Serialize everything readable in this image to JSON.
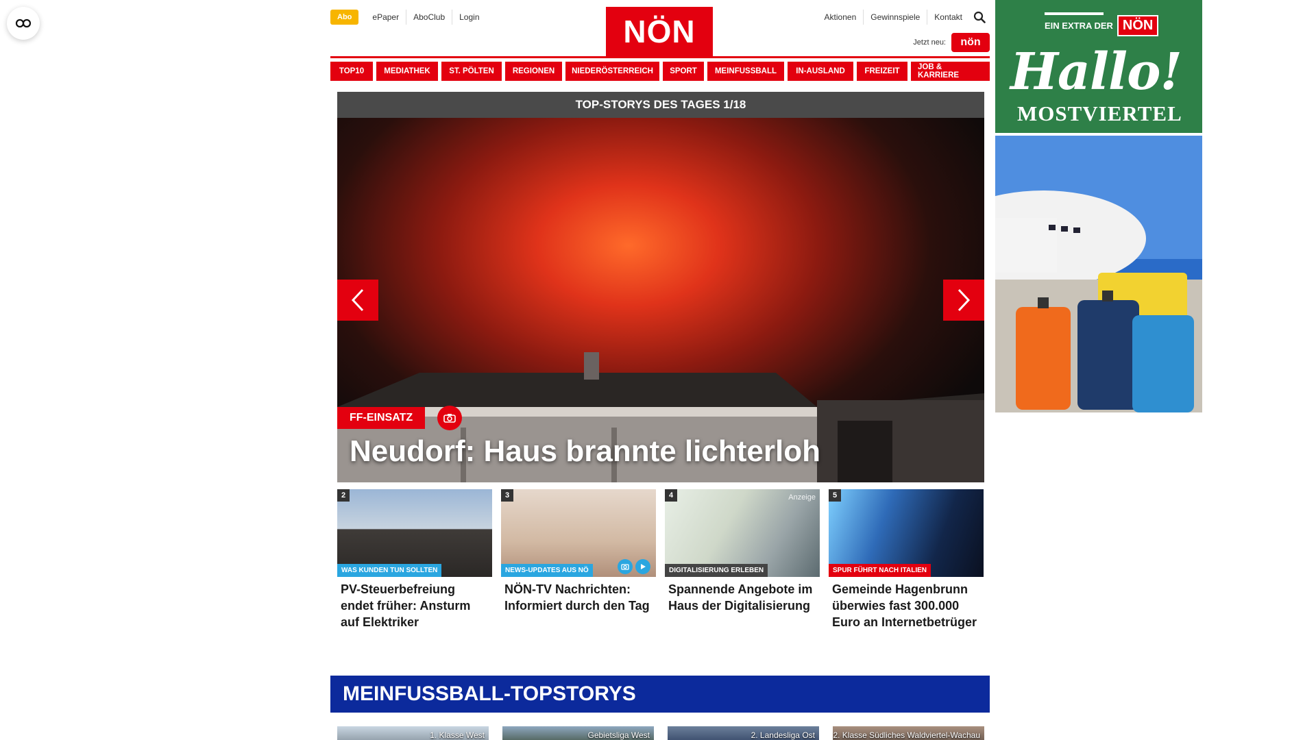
{
  "header": {
    "abo_label": "Abo",
    "epaper_label": "ePaper",
    "aboclub_label": "AboClub",
    "login_label": "Login",
    "logo_text": "NÖN",
    "aktionen_label": "Aktionen",
    "gewinnspiele_label": "Gewinnspiele",
    "kontakt_label": "Kontakt",
    "jetzt_neu_label": "Jetzt neu:",
    "mini_logo_text": "nön"
  },
  "nav": {
    "items": [
      {
        "label": "TOP10"
      },
      {
        "label": "MEDIATHEK"
      },
      {
        "label": "ST. PÖLTEN"
      },
      {
        "label": "REGIONEN"
      },
      {
        "label": "NIEDERÖSTERREICH"
      },
      {
        "label": "SPORT"
      },
      {
        "label": "MEINFUSSBALL"
      },
      {
        "label": "IN-AUSLAND"
      },
      {
        "label": "FREIZEIT"
      },
      {
        "label": "JOB & KARRIERE"
      }
    ]
  },
  "slider": {
    "header": "TOP-STORYS DES TAGES 1/18",
    "tag": "FF-EINSATZ",
    "title": "Neudorf: Haus brannte lichterloh"
  },
  "stories": [
    {
      "num": "2",
      "tag": "WAS KUNDEN TUN SOLLTEN",
      "tag_color": "#2aa6e0",
      "title": "PV-Steuerbefreiung endet früher: Ansturm auf Elektriker"
    },
    {
      "num": "3",
      "tag": "NEWS-UPDATES AUS NÖ",
      "tag_color": "#2aa6e0",
      "title": "NÖN-TV Nachrichten: Informiert durch den Tag"
    },
    {
      "num": "4",
      "tag": "DIGITALISIERUNG ERLEBEN",
      "tag_color": "#444444",
      "title": "Spannende Angebote im Haus der Digitalisierung",
      "badge": "Anzeige"
    },
    {
      "num": "5",
      "tag": "SPUR FÜHRT NACH ITALIEN",
      "tag_color": "#e3000f",
      "title": "Gemeinde Hagenbrunn überwies fast 300.000 Euro an Internetbetrüger"
    }
  ],
  "meinfussball": {
    "title": "MEINFUSSBALL-TOPSTORYS",
    "leagues": [
      {
        "label": "1. Klasse West"
      },
      {
        "label": "Gebietsliga West"
      },
      {
        "label": "2. Landesliga Ost"
      },
      {
        "label": "2. Klasse Südliches Waldviertel-Wachau"
      }
    ]
  },
  "ad": {
    "extra_label": "EIN EXTRA DER",
    "extra_logo": "NÖN",
    "hallo": "Hallo!",
    "region": "MOSTVIERTEL"
  },
  "colors": {
    "brand_red": "#e3000f",
    "abo_yellow": "#f7b500",
    "mf_blue": "#0c2a9c",
    "ad_green": "#2e8048"
  }
}
